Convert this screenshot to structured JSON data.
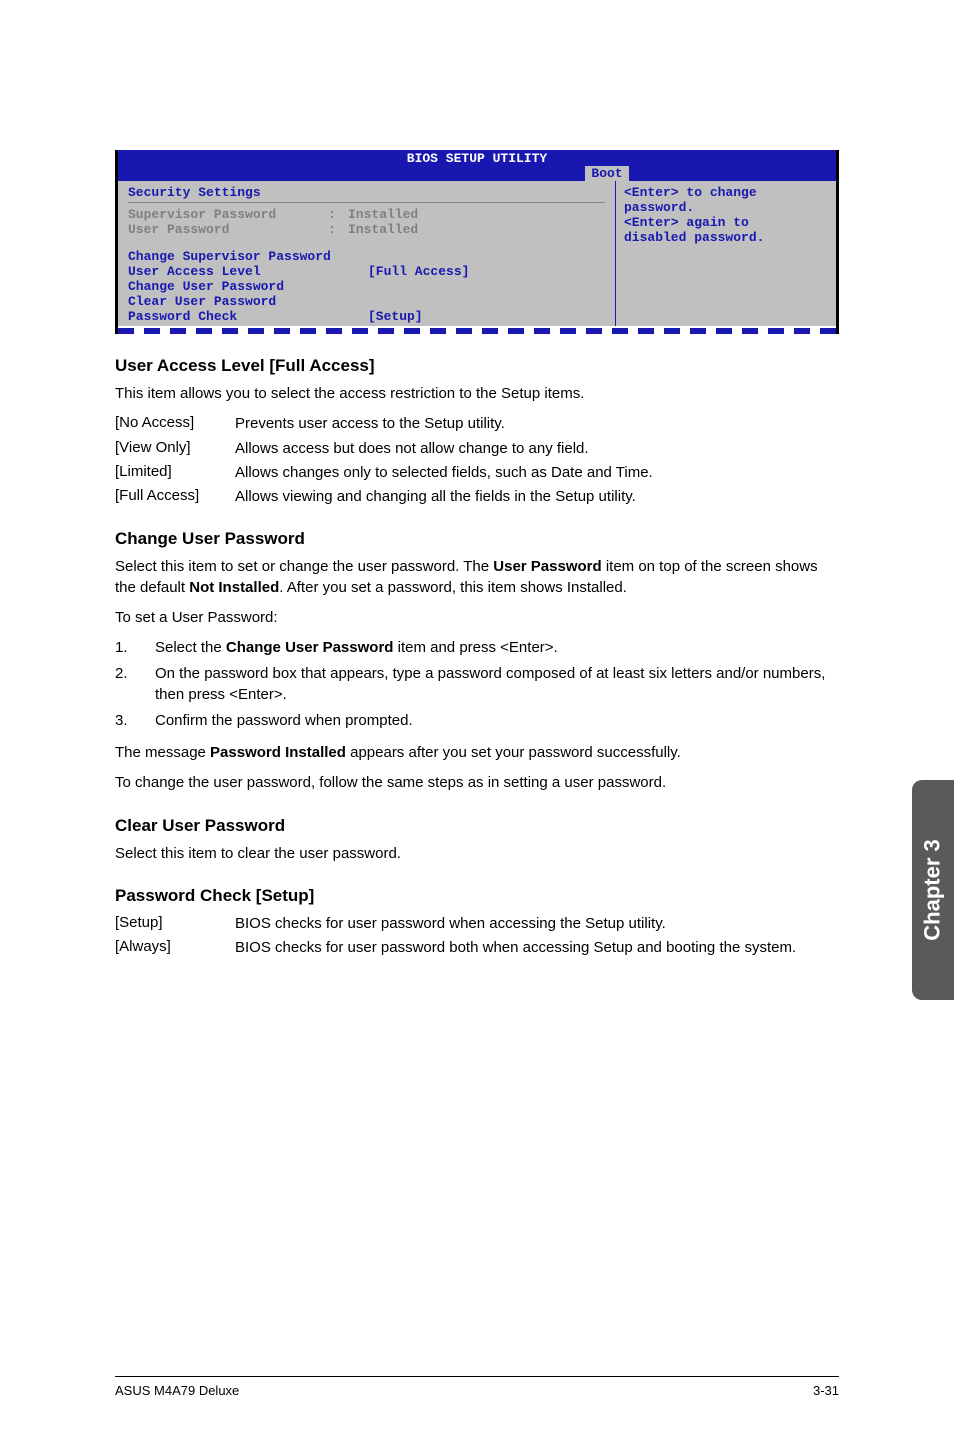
{
  "bios": {
    "title": "BIOS SETUP UTILITY",
    "tab": "Boot",
    "section": "Security Settings",
    "rows": {
      "supervisor_label": "Supervisor Password",
      "supervisor_val": "Installed",
      "user_label": "User Password",
      "user_val": "Installed",
      "change_sup": "Change Supervisor Password",
      "ual_label": "User Access Level",
      "ual_val": "[Full Access]",
      "change_user": "Change User Password",
      "clear_user": "Clear User Password",
      "pwd_check_label": "Password Check",
      "pwd_check_val": "[Setup]"
    },
    "help": {
      "l1": "<Enter> to change",
      "l2": "password.",
      "l3": "<Enter> again to",
      "l4": "disabled password."
    }
  },
  "sections": {
    "ual": {
      "heading": "User Access Level [Full Access]",
      "intro": "This item allows you to select the access restriction to the Setup items.",
      "opts": [
        {
          "term": "[No Access]",
          "desc": "Prevents user access to the Setup utility."
        },
        {
          "term": "[View Only]",
          "desc": "Allows access but does not allow change to any field."
        },
        {
          "term": "[Limited]",
          "desc": "Allows changes only to selected fields, such as Date and Time."
        },
        {
          "term": "[Full Access]",
          "desc": "Allows viewing and changing all the fields in the Setup utility."
        }
      ]
    },
    "cup": {
      "heading": "Change User Password",
      "p1a": "Select this item to set or change the user password. The ",
      "p1b": "User Password",
      "p1c": " item on top of the screen shows the default ",
      "p1d": "Not Installed",
      "p1e": ". After you set a password, this item shows Installed.",
      "p2": "To set a User Password:",
      "steps": [
        {
          "n": "1.",
          "a": "Select the ",
          "b": "Change User Password",
          "c": " item and press <Enter>."
        },
        {
          "n": "2.",
          "a": "On the password box that appears, type a password composed of at least six letters and/or numbers, then press <Enter>.",
          "b": "",
          "c": ""
        },
        {
          "n": "3.",
          "a": "Confirm the password when prompted.",
          "b": "",
          "c": ""
        }
      ],
      "p3a": "The message ",
      "p3b": "Password Installed",
      "p3c": " appears after you set your password successfully.",
      "p4": "To change the user password, follow the same steps as in setting a user password."
    },
    "clp": {
      "heading": "Clear User Password",
      "p": "Select this item to clear the user password."
    },
    "pwc": {
      "heading": "Password Check [Setup]",
      "opts": [
        {
          "term": "[Setup]",
          "desc": "BIOS checks for user password when accessing the Setup utility."
        },
        {
          "term": "[Always]",
          "desc": "BIOS checks for user password both when accessing Setup and booting the system."
        }
      ]
    }
  },
  "side_tab": "Chapter 3",
  "footer": {
    "left": "ASUS M4A79 Deluxe",
    "right": "3-31"
  }
}
